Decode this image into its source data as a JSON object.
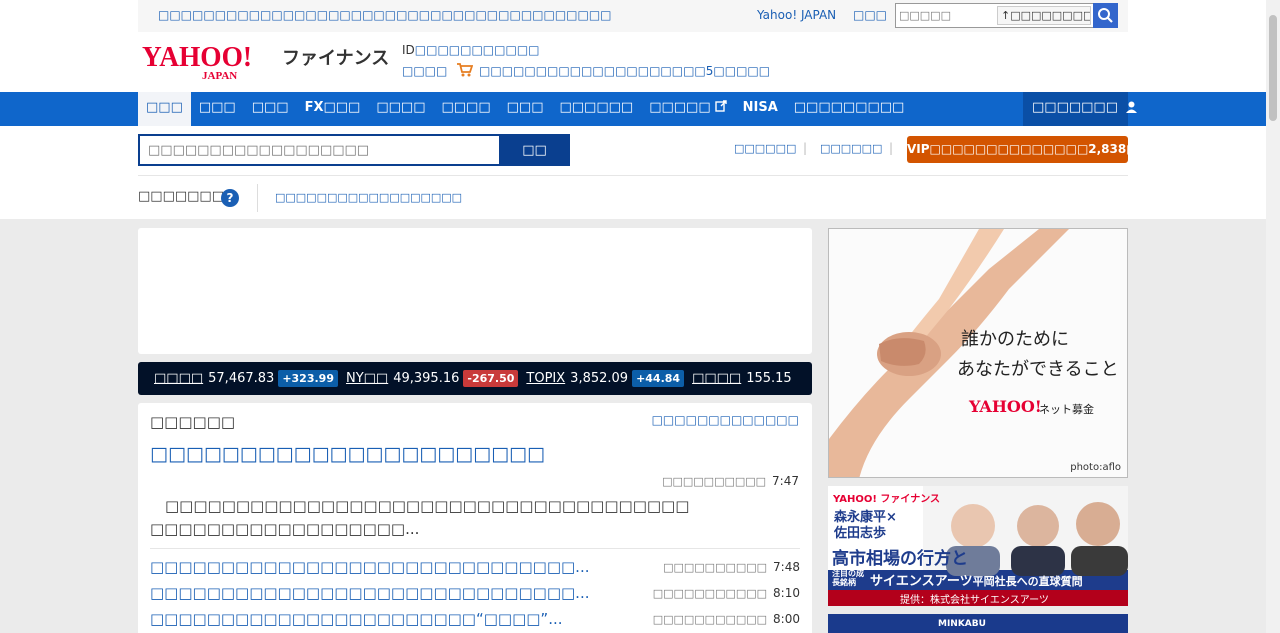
{
  "topbar": {
    "notice": "□□□□□□□□□□□□□□□□□□□□□□□□□□□□□□□□□□□□□□□□",
    "yahoo_japan": "Yahoo! JAPAN",
    "help": "□□□",
    "search_placeholder": "□□□□□",
    "keyword_btn": "□□□□□□□□□"
  },
  "header": {
    "site_name": "ファイナンス",
    "login_prefix": "ID",
    "login_link": "□□□□□□□□□□□",
    "promo_label": "□□□□",
    "promo_text": "□□□□□□□□□□□□□□□□□□□□5□□□□□"
  },
  "nav": {
    "items": [
      {
        "label": "□□□"
      },
      {
        "label": "□□□"
      },
      {
        "label": "□□□"
      },
      {
        "label": "FX□□□"
      },
      {
        "label": "□□□□"
      },
      {
        "label": "□□□□"
      },
      {
        "label": "□□□"
      },
      {
        "label": "□□□□□□"
      },
      {
        "label": "□□□□□"
      },
      {
        "label": "NISA"
      },
      {
        "label": "□□□□□□□□□"
      }
    ],
    "mypage": "□□□□□□□"
  },
  "search": {
    "placeholder": "□□□□□□□□□□□□□□□□□□",
    "button": "□□",
    "link1": "□□□□□□",
    "link2": "□□□□□□",
    "vip": "VIP□□□□□□□□□□□□□□2,838□□"
  },
  "subrow": {
    "label": "□□□□□□□",
    "help": "?",
    "link": "□□□□□□□□□□□□□□□□□□"
  },
  "ticker": [
    {
      "name": "□□□□",
      "value": "57,467.83",
      "change": "+323.99",
      "dir": "up"
    },
    {
      "name": "NY□□",
      "value": "49,395.16",
      "change": "-267.50",
      "dir": "down"
    },
    {
      "name": "TOPIX",
      "value": "3,852.09",
      "change": "+44.84",
      "dir": "up"
    },
    {
      "name": "□□□□",
      "value": "155.15",
      "change": "",
      "dir": "none"
    }
  ],
  "news": {
    "title": "□□□□□□",
    "more": "□□□□□□□□□□□□□",
    "headline": "□□□□□□□□□□□□□□□□□□□□□□",
    "headline_source": "□□□□□□□□□□",
    "headline_time": "7:47",
    "lead": "　□□□□□□□□□□□□□□□□□□□□□□□□□□□□□□□□□□□□□　□□□□□□□□□□□□□□□□□□...",
    "items": [
      {
        "title": "□□□□□□□□□□□□□□□□□□□□□□□□□□□□□□...",
        "source": "□□□□□□□□□□",
        "time": "7:48"
      },
      {
        "title": "□□□□□□□□□□□□□□□□□□□□□□□□□□□□□□...",
        "source": "□□□□□□□□□□□",
        "time": "8:10"
      },
      {
        "title": "□□□□□□□□□□□□□□□□□□□□□□□“□□□□”...",
        "source": "□□□□□□□□□□□",
        "time": "8:00"
      }
    ]
  },
  "ads": {
    "ad1_line1": "誰かのために",
    "ad1_line2": "あなたができること",
    "ad1_brand_sub": "ネット募金",
    "ad1_credit": "photo:aflo",
    "ad2_line1": "森永康平×",
    "ad2_line2": "佐田志歩",
    "ad2_line3": "高市相場の行方と",
    "ad2_line4": "サイエンスアーツ",
    "ad2_line4b": "平岡社長への直球質問",
    "ad2_sponsor": "提供：株式会社サイエンスアーツ",
    "ad2_tag": "注目の成長銘柄",
    "ad3_text": "MINKABU"
  },
  "colors": {
    "nav": "#0f66cb",
    "brand_red": "#e60033",
    "vip": "#d35400",
    "ticker_bg": "#021128",
    "link": "#1a5fb4"
  }
}
